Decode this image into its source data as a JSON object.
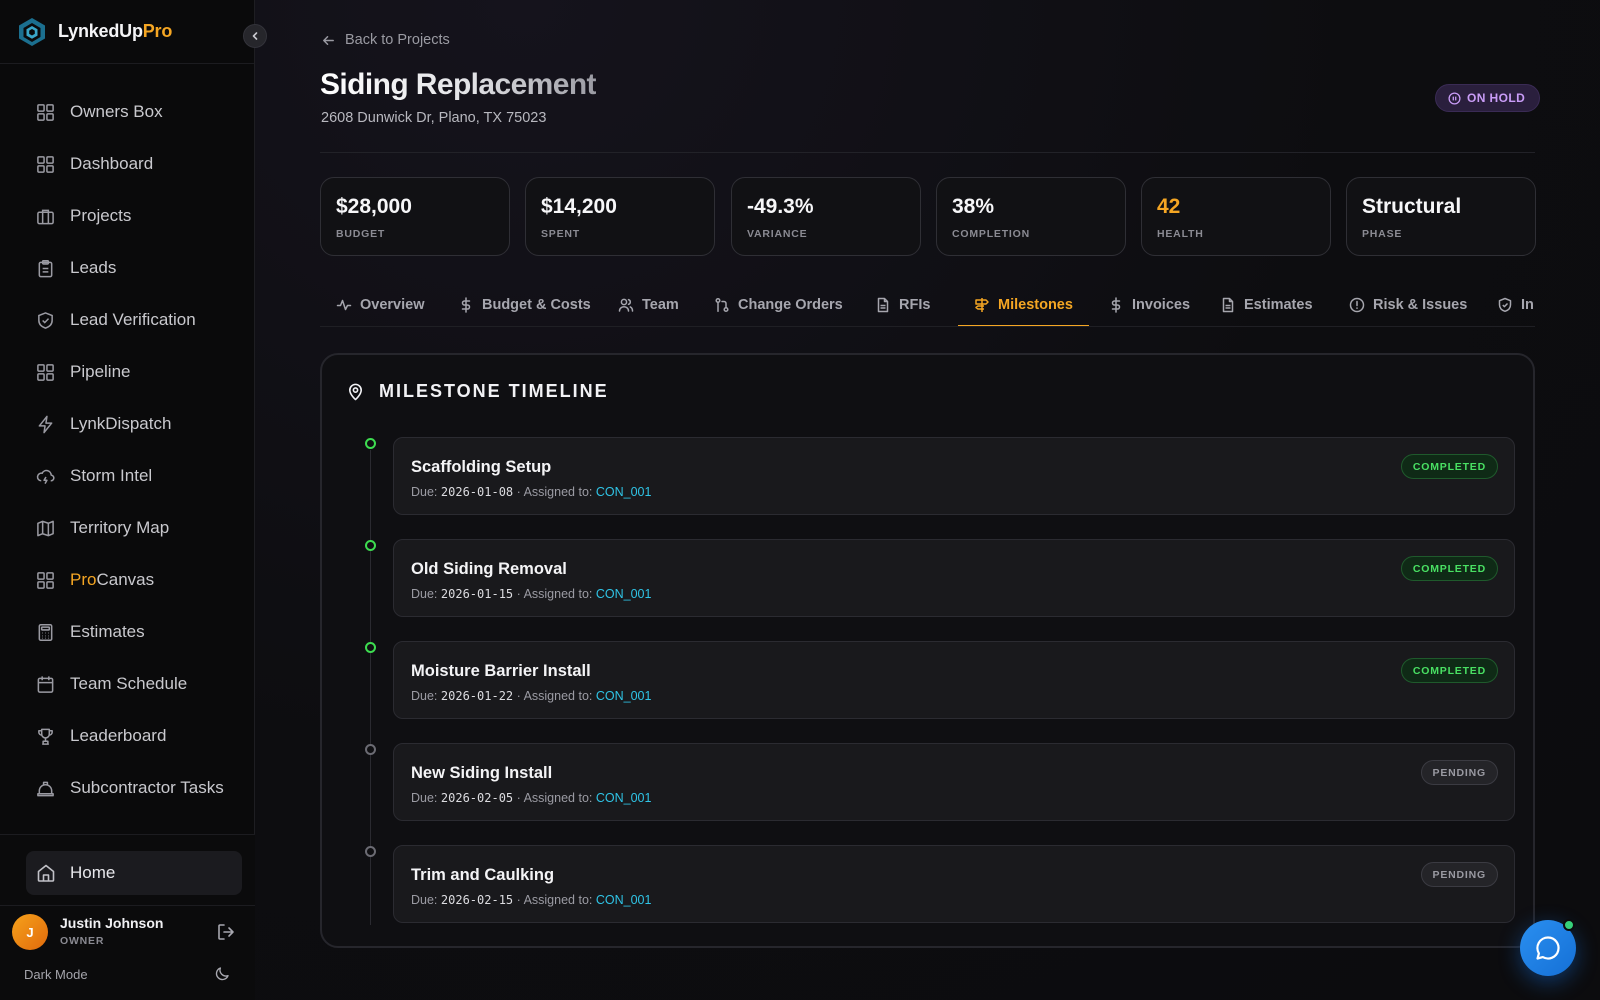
{
  "brand": {
    "name": "LynkedUp",
    "accent": "Pro"
  },
  "sidebar": {
    "items": [
      {
        "label": "Owners Box",
        "icon": "grid-icon"
      },
      {
        "label": "Dashboard",
        "icon": "grid-icon"
      },
      {
        "label": "Projects",
        "icon": "briefcase-icon"
      },
      {
        "label": "Leads",
        "icon": "clipboard-icon"
      },
      {
        "label": "Lead Verification",
        "icon": "shield-check-icon"
      },
      {
        "label": "Pipeline",
        "icon": "grid-icon"
      },
      {
        "label": "LynkDispatch",
        "icon": "bolt-icon"
      },
      {
        "label": "Storm Intel",
        "icon": "cloud-lightning-icon"
      },
      {
        "label": "Territory Map",
        "icon": "map-icon"
      },
      {
        "label_pre": "Pro",
        "label": "Canvas",
        "icon": "grid-icon"
      },
      {
        "label": "Estimates",
        "icon": "calculator-icon"
      },
      {
        "label": "Team Schedule",
        "icon": "calendar-icon"
      },
      {
        "label": "Leaderboard",
        "icon": "trophy-icon"
      },
      {
        "label": "Subcontractor Tasks",
        "icon": "hardhat-icon"
      }
    ],
    "home_label": "Home",
    "user": {
      "initial": "J",
      "name": "Justin Johnson",
      "role": "OWNER"
    },
    "dark_mode_label": "Dark Mode"
  },
  "header": {
    "back_label": "Back to Projects",
    "title": "Siding Replacement",
    "address": "2608 Dunwick Dr, Plano, TX 75023",
    "status": "ON HOLD"
  },
  "stats": [
    {
      "value": "$28,000",
      "label": "BUDGET"
    },
    {
      "value": "$14,200",
      "label": "SPENT"
    },
    {
      "value": "-49.3%",
      "label": "VARIANCE"
    },
    {
      "value": "38%",
      "label": "COMPLETION"
    },
    {
      "value": "42",
      "label": "HEALTH"
    },
    {
      "value": "Structural",
      "label": "PHASE"
    }
  ],
  "tabs": [
    {
      "label": "Overview",
      "icon": "activity-icon"
    },
    {
      "label": "Budget & Costs",
      "icon": "dollar-icon"
    },
    {
      "label": "Team",
      "icon": "users-icon"
    },
    {
      "label": "Change Orders",
      "icon": "git-pull-icon"
    },
    {
      "label": "RFIs",
      "icon": "file-icon"
    },
    {
      "label": "Milestones",
      "icon": "signpost-icon"
    },
    {
      "label": "Invoices",
      "icon": "dollar-icon"
    },
    {
      "label": "Estimates",
      "icon": "file-icon"
    },
    {
      "label": "Risk & Issues",
      "icon": "alert-circle-icon"
    },
    {
      "label": "In",
      "icon": "shield-icon"
    }
  ],
  "active_tab": "Milestones",
  "timeline": {
    "title": "MILESTONE TIMELINE",
    "due_prefix": "Due:",
    "assigned_prefix": "· Assigned to:",
    "milestones": [
      {
        "title": "Scaffolding Setup",
        "due": "2026-01-08",
        "assignee": "CON_001",
        "status": "COMPLETED"
      },
      {
        "title": "Old Siding Removal",
        "due": "2026-01-15",
        "assignee": "CON_001",
        "status": "COMPLETED"
      },
      {
        "title": "Moisture Barrier Install",
        "due": "2026-01-22",
        "assignee": "CON_001",
        "status": "COMPLETED"
      },
      {
        "title": "New Siding Install",
        "due": "2026-02-05",
        "assignee": "CON_001",
        "status": "PENDING"
      },
      {
        "title": "Trim and Caulking",
        "due": "2026-02-15",
        "assignee": "CON_001",
        "status": "PENDING"
      }
    ]
  },
  "colors": {
    "accent": "#f5a623",
    "completed": "#49e063",
    "on_hold": "#c99cf7",
    "assignee": "#2fc4e6",
    "chat": "#1f86e8"
  }
}
